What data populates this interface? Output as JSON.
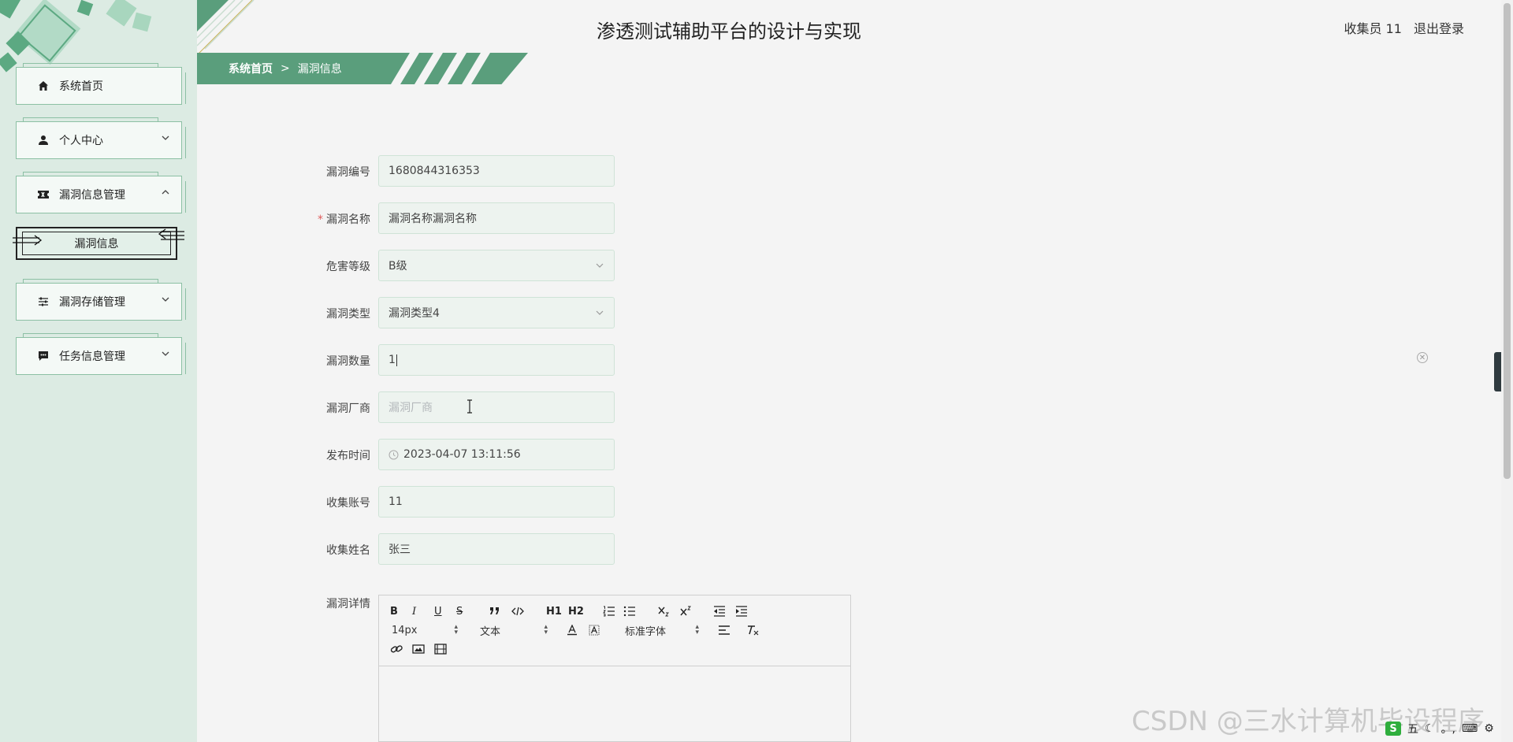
{
  "app": {
    "title": "渗透测试辅助平台的设计与实现"
  },
  "user": {
    "name": "收集员 11",
    "logout_label": "退出登录"
  },
  "breadcrumb": {
    "home": "系统首页",
    "separator": ">",
    "current": "漏洞信息"
  },
  "sidebar": {
    "items": [
      {
        "label": "系统首页",
        "icon": "home-icon"
      },
      {
        "label": "个人中心",
        "icon": "person-icon"
      },
      {
        "label": "漏洞信息管理",
        "icon": "ticket-icon"
      },
      {
        "label": "漏洞存储管理",
        "icon": "sliders-icon"
      },
      {
        "label": "任务信息管理",
        "icon": "chat-icon"
      }
    ],
    "sub_item": {
      "label": "漏洞信息"
    }
  },
  "form": {
    "code": {
      "label": "漏洞编号",
      "value": "1680844316353"
    },
    "name": {
      "label": "漏洞名称",
      "required_mark": "*",
      "value": "漏洞名称漏洞名称"
    },
    "level": {
      "label": "危害等级",
      "value": "B级"
    },
    "type": {
      "label": "漏洞类型",
      "value": "漏洞类型4"
    },
    "count": {
      "label": "漏洞数量",
      "value": "1"
    },
    "vendor": {
      "label": "漏洞厂商",
      "placeholder": "漏洞厂商"
    },
    "publish_time": {
      "label": "发布时间",
      "value": "2023-04-07 13:11:56"
    },
    "account": {
      "label": "收集账号",
      "value": "11"
    },
    "collector_name": {
      "label": "收集姓名",
      "value": "张三"
    },
    "details": {
      "label": "漏洞详情"
    }
  },
  "editor": {
    "font_size": "14px",
    "text_style": "文本",
    "font_family": "标准字体",
    "bold": "B",
    "italic": "I",
    "underline": "U",
    "strike": "S",
    "h1": "H1",
    "h2": "H2"
  },
  "watermark": "CSDN @三水计算机毕设程序",
  "tray": {
    "ime": "五",
    "punct": "。,"
  },
  "colors": {
    "accent": "#5a9e7c",
    "sidebar_bg": "#dcebe3",
    "page_bg": "#f4f4f4"
  }
}
